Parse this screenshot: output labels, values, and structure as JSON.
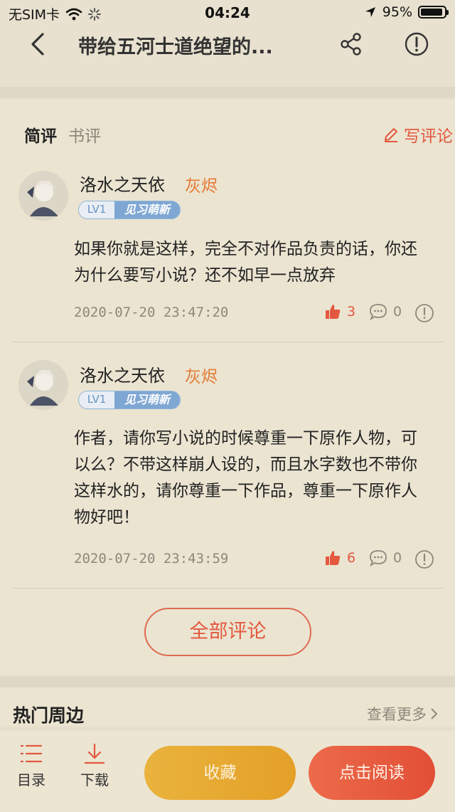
{
  "status_bar": {
    "carrier": "无SIM卡",
    "time": "04:24",
    "battery_percent": "95%",
    "battery_level": 0.95
  },
  "nav": {
    "title": "带给五河士道绝望的..."
  },
  "reviews": {
    "tabs": [
      "简评",
      "书评"
    ],
    "write_label": "写评论",
    "comments": [
      {
        "username": "洛水之天依",
        "tag": "灰烬",
        "level": "LV1",
        "level_name": "见习萌新",
        "text": "如果你就是这样，完全不对作品负责的话，你还为什么要写小说？还不如早一点放弃",
        "time": "2020-07-20 23:47:20",
        "likes": "3",
        "replies": "0"
      },
      {
        "username": "洛水之天依",
        "tag": "灰烬",
        "level": "LV1",
        "level_name": "见习萌新",
        "text": "作者，请你写小说的时候尊重一下原作人物，可以么？不带这样崩人设的，而且水字数也不带你这样水的，请你尊重一下作品，尊重一下原作人物好吧！",
        "time": "2020-07-20 23:43:59",
        "likes": "6",
        "replies": "0"
      }
    ],
    "all_label": "全部评论"
  },
  "hot": {
    "title": "热门周边",
    "more": "查看更多"
  },
  "bottom_bar": {
    "catalog": "目录",
    "download": "下载",
    "favorite": "收藏",
    "read": "点击阅读"
  },
  "colors": {
    "accent": "#e3583e",
    "tag": "#e47b36",
    "background": "#e8e1cf"
  }
}
